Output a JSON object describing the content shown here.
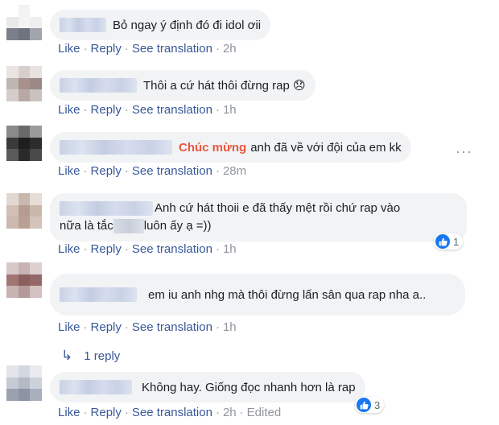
{
  "comments": [
    {
      "text_pre": "",
      "highlight": "",
      "text": "Bỏ ngay ý định đó đi idol ơii",
      "actions": {
        "like": "Like",
        "reply": "Reply",
        "translate": "See translation",
        "time": "2h"
      }
    },
    {
      "text_pre": "",
      "highlight": "",
      "text": "Thôi a cứ hát thôi đừng rap 😞",
      "actions": {
        "like": "Like",
        "reply": "Reply",
        "translate": "See translation",
        "time": "1h"
      }
    },
    {
      "highlight": "Chúc mừng",
      "text": "anh đã về với đội của em kk",
      "actions": {
        "like": "Like",
        "reply": "Reply",
        "translate": "See translation",
        "time": "28m"
      }
    },
    {
      "text_line1": "Anh cứ hát thoii e đã thấy mệt rồi chứ rap vào",
      "text_line2a": "nữa là tắc",
      "text_line2b": "luôn ấy ạ =))",
      "reactions": "1",
      "actions": {
        "like": "Like",
        "reply": "Reply",
        "translate": "See translation",
        "time": "1h"
      }
    },
    {
      "text": "em iu anh nhg mà thôi đừng lấn sân qua rap nha a..",
      "actions": {
        "like": "Like",
        "reply": "Reply",
        "translate": "See translation",
        "time": "1h"
      },
      "replies_label": "1 reply"
    },
    {
      "text": "Không hay. Giống đọc nhanh hơn là rap",
      "reactions": "3",
      "actions": {
        "like": "Like",
        "reply": "Reply",
        "translate": "See translation",
        "time": "2h",
        "edited": "Edited"
      }
    }
  ],
  "icons": {
    "more": "more-options-icon",
    "like": "like-thumb-icon",
    "reply_arrow": "reply-arrow-icon"
  },
  "colors": {
    "link": "#385898",
    "bubble": "#f2f3f5",
    "highlight": "#e9573f",
    "like_blue": "#1877f2"
  }
}
